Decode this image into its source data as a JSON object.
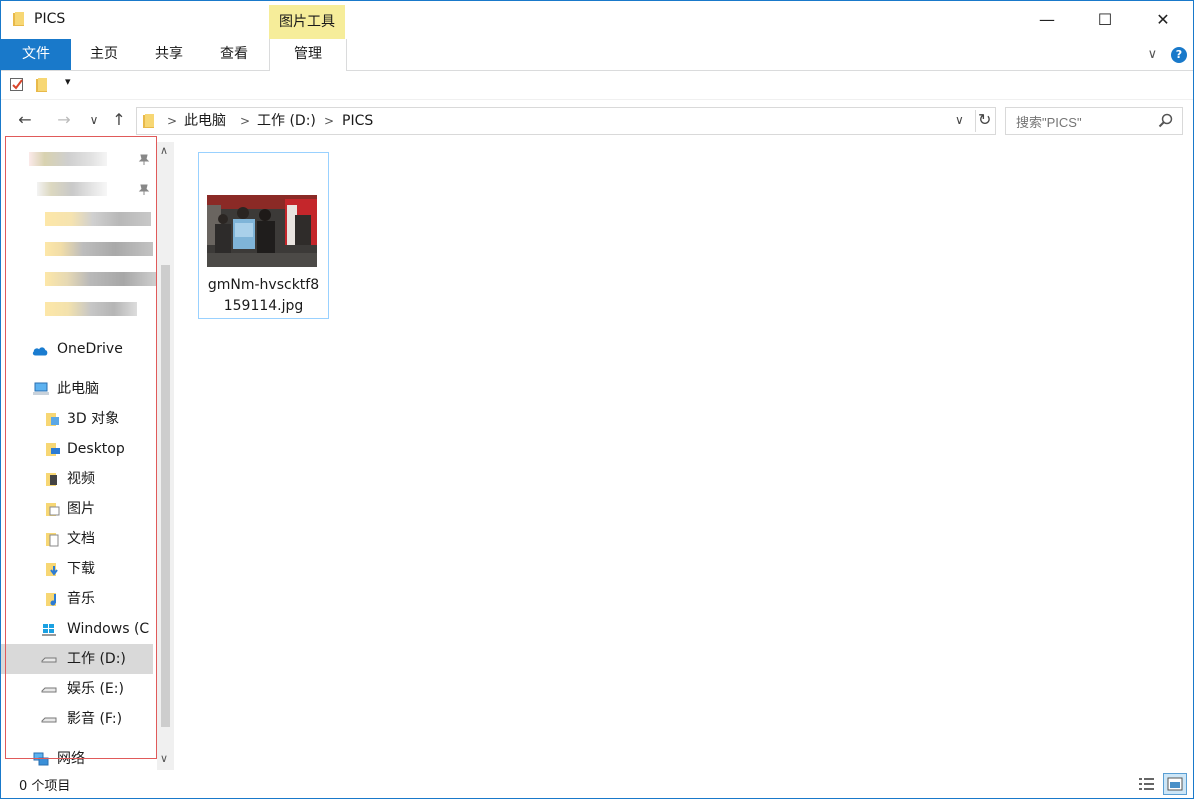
{
  "window": {
    "title": "PICS",
    "minimize": "—",
    "maximize": "☐",
    "close": "✕"
  },
  "ribbon": {
    "context_group": "图片工具",
    "tabs": [
      "文件",
      "主页",
      "共享",
      "查看",
      "管理"
    ],
    "expand_chevron": "∨",
    "help": "?"
  },
  "quick_access": {
    "dropdown": "▾"
  },
  "address": {
    "back": "←",
    "forward": "→",
    "recent": "∨",
    "up": "↑",
    "breadcrumb": [
      "此电脑",
      "工作 (D:)",
      "PICS"
    ],
    "separator": ">",
    "dropdown": "∨",
    "refresh": "↻"
  },
  "search": {
    "placeholder": "搜索\"PICS\"",
    "icon": "search-icon"
  },
  "nav": {
    "onedrive": "OneDrive",
    "this_pc": "此电脑",
    "items": [
      "3D 对象",
      "Desktop",
      "视频",
      "图片",
      "文档",
      "下载",
      "音乐",
      "Windows (C",
      "工作 (D:)",
      "娱乐 (E:)",
      "影音 (F:)"
    ],
    "network": "网络",
    "scroll_up": "∧",
    "scroll_down": "∨"
  },
  "files": [
    {
      "name": "gmNm-hvscktf8159114.jpg",
      "name_line1": "gmNm-hvscktf8",
      "name_line2": "159114.jpg"
    }
  ],
  "status": {
    "count": "0 个项目"
  },
  "colors": {
    "accent": "#1979ca",
    "context_tab": "#f6ed9a",
    "selection_border": "#99d1ff",
    "highlight_box": "#e05a5a"
  }
}
